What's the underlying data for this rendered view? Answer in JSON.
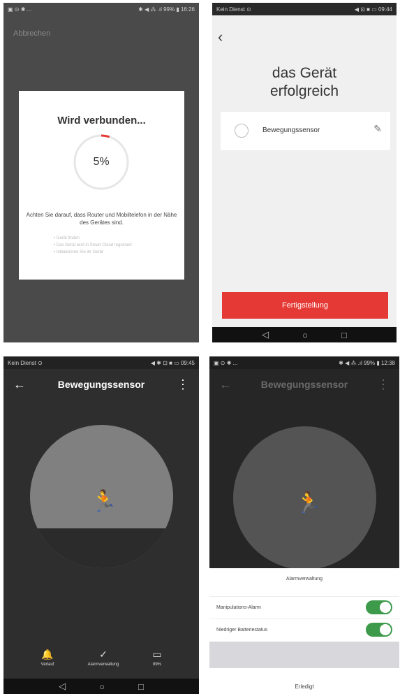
{
  "phone1": {
    "status_left": "▣ ⊙ ✱ ...",
    "status_right": "✱ ◀ ⁂ .ıl 99% ▮ 16:26",
    "cancel": "Abbrechen",
    "dialog_title": "Wird verbunden...",
    "progress_percent": 5,
    "progress_label": "5%",
    "note": "Achten Sie darauf, dass Router und Mobiltelefon in der Nähe des Gerätes sind.",
    "steps": [
      "Gerät finden",
      "Das Gerät wird in Smart Cloud registriert",
      "Initialisieren Sie ihr Gerät"
    ]
  },
  "phone2": {
    "status_left": "Kein Dienst ⊙",
    "status_right": "◀ ⊡ ■ ▭ 09:44",
    "back_icon": "chevron-left-icon",
    "headline_1": "das Gerät",
    "headline_2": "erfolgreich",
    "device_name": "Bewegungssensor",
    "finish_button": "Fertigstellung"
  },
  "phone3": {
    "status_left": "Kein Dienst ⊙",
    "status_right": "◀ ✱ ⊡ ■ ▭ 09:45",
    "title": "Bewegungssensor",
    "tabs": [
      {
        "icon": "bell-icon",
        "glyph": "🔔",
        "label": "Verlauf"
      },
      {
        "icon": "shield-check-icon",
        "glyph": "✓",
        "label": "Alarmverwaltung"
      },
      {
        "icon": "battery-icon",
        "glyph": "▭",
        "label": "89%"
      }
    ]
  },
  "phone4": {
    "status_left": "▣ ⊙ ✱ ...",
    "status_right": "✱ ◀ ⁂ .ıl 99% ▮ 12:38",
    "title": "Bewegungssensor",
    "sheet_title": "Alarmverwaltung",
    "rows": [
      {
        "label": "Manipulations-Alarm",
        "on": true
      },
      {
        "label": "Niedriger Batteriestatus",
        "on": true
      }
    ],
    "done": "Erledigt"
  },
  "nav": {
    "back": "◁",
    "home": "○",
    "recent": "□"
  },
  "colors": {
    "accent_red": "#e53935",
    "toggle_green": "#3c9a4a"
  }
}
